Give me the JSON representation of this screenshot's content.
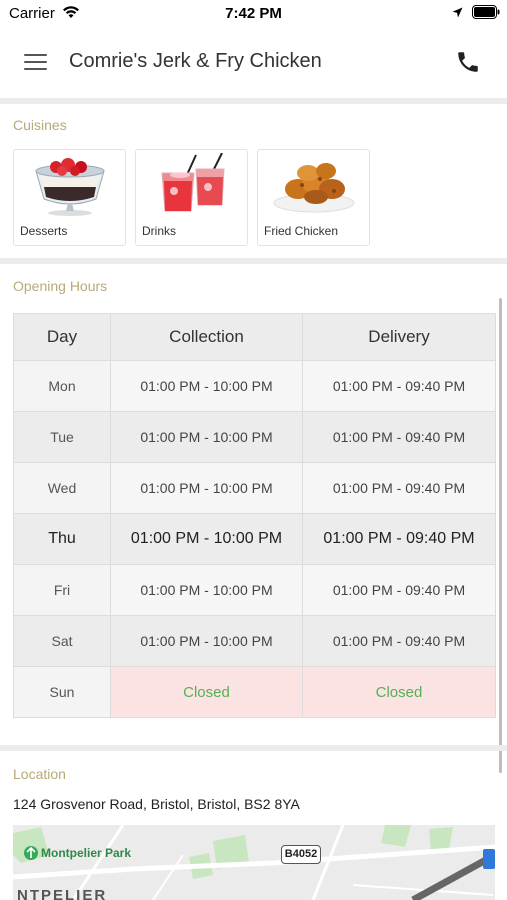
{
  "status_bar": {
    "carrier": "Carrier",
    "time": "7:42 PM"
  },
  "header": {
    "title": "Comrie's Jerk & Fry Chicken",
    "menu_icon": "hamburger-menu-icon",
    "phone_icon": "phone-icon"
  },
  "cuisines": {
    "label": "Cuisines",
    "items": [
      {
        "label": "Desserts",
        "icon": "desserts-image"
      },
      {
        "label": "Drinks",
        "icon": "drinks-image"
      },
      {
        "label": "Fried Chicken",
        "icon": "fried-chicken-image"
      }
    ]
  },
  "opening_hours": {
    "label": "Opening Hours",
    "columns": [
      "Day",
      "Collection",
      "Delivery"
    ],
    "rows": [
      {
        "day": "Mon",
        "collection": "01:00 PM - 10:00 PM",
        "delivery": "01:00 PM - 09:40 PM"
      },
      {
        "day": "Tue",
        "collection": "01:00 PM - 10:00 PM",
        "delivery": "01:00 PM - 09:40 PM"
      },
      {
        "day": "Wed",
        "collection": "01:00 PM - 10:00 PM",
        "delivery": "01:00 PM - 09:40 PM"
      },
      {
        "day": "Thu",
        "collection": "01:00 PM - 10:00 PM",
        "delivery": "01:00 PM - 09:40 PM"
      },
      {
        "day": "Fri",
        "collection": "01:00 PM - 10:00 PM",
        "delivery": "01:00 PM - 09:40 PM"
      },
      {
        "day": "Sat",
        "collection": "01:00 PM - 10:00 PM",
        "delivery": "01:00 PM - 09:40 PM"
      },
      {
        "day": "Sun",
        "collection": "Closed",
        "delivery": "Closed"
      }
    ],
    "today": "Thu"
  },
  "location": {
    "label": "Location",
    "address": "124 Grosvenor Road, Bristol, Bristol, BS2 8YA",
    "map": {
      "park_label": "Montpelier Park",
      "road_label": "B4052",
      "area_label": "NTPELIER"
    }
  },
  "colors": {
    "section_label": "#b8aa76",
    "closed_bg": "#fbe3e3",
    "closed_text": "#55b055",
    "divider": "#ececec"
  }
}
